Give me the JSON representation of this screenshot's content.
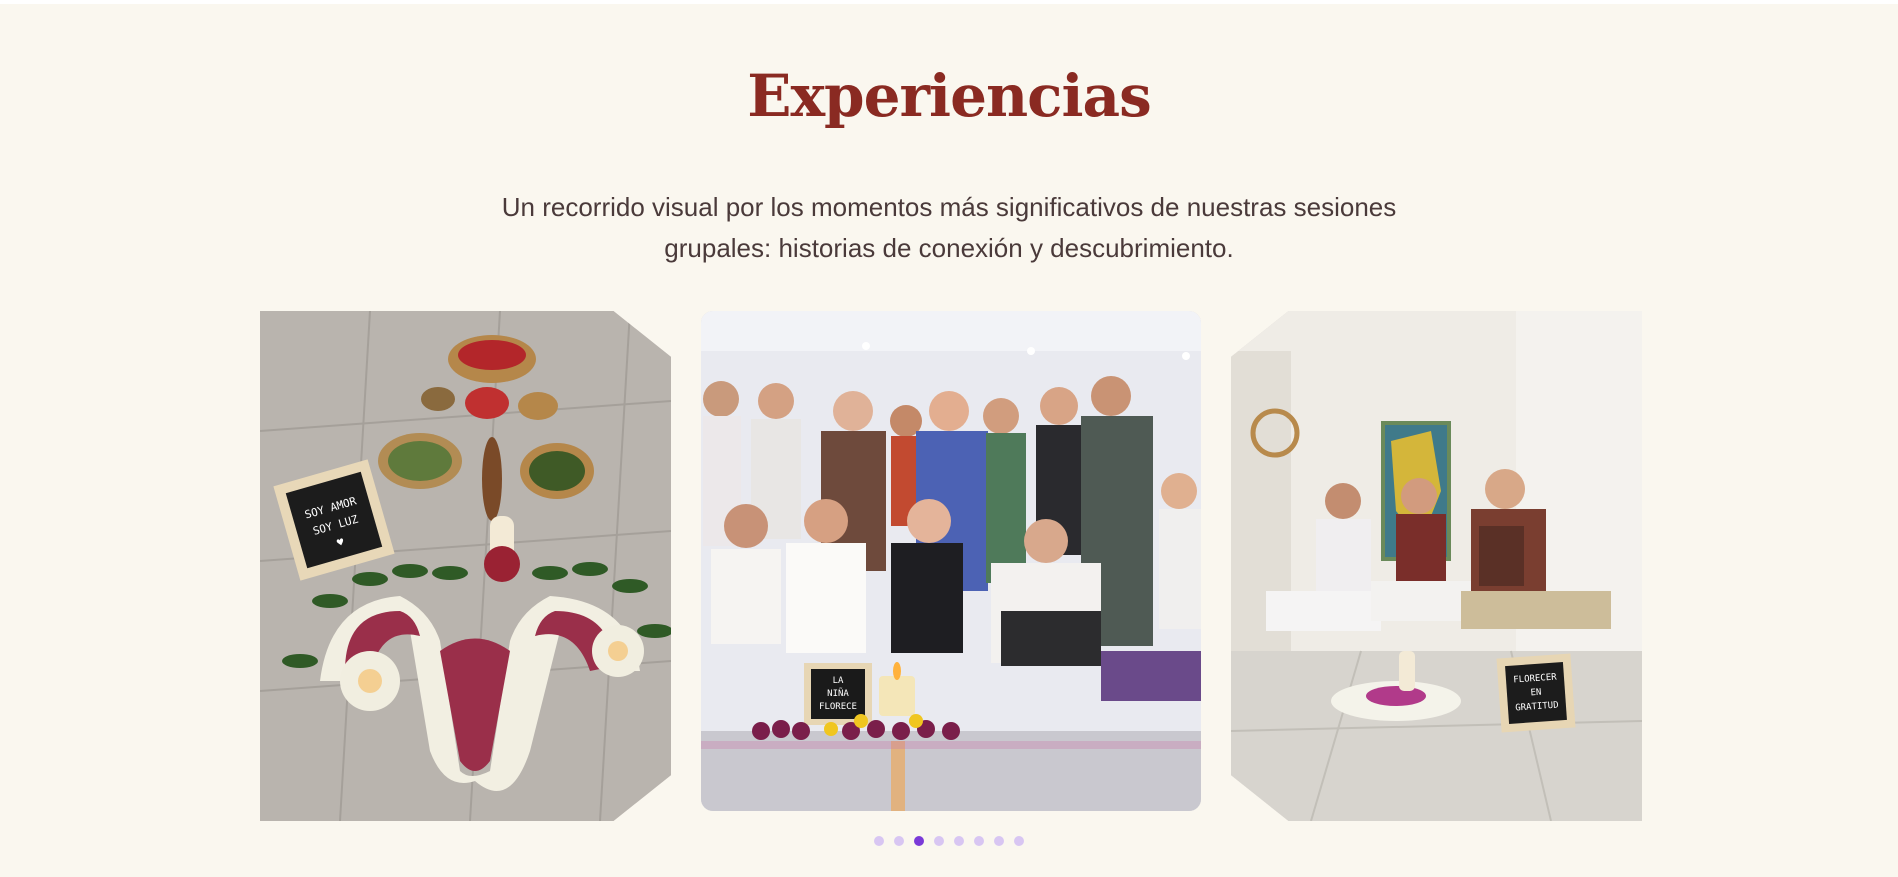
{
  "section": {
    "title": "Experiencias",
    "subtitle": "Un recorrido visual por los momentos más significativos de nuestras sesiones grupales: historias de conexión y descubrimiento."
  },
  "carousel": {
    "slides": [
      {
        "sign_lines": [
          "SOY AMOR",
          "SOY LUZ",
          "♥"
        ]
      },
      {
        "sign_lines": [
          "LA",
          "NIÑA",
          "FLORECE"
        ]
      },
      {
        "sign_lines": [
          "FLORECER",
          "EN",
          "GRATITUD"
        ]
      }
    ],
    "dot_count": 8,
    "active_index": 2
  },
  "colors": {
    "title": "#8a2a22",
    "background": "#faf7ef",
    "dot": "#d8c6f2",
    "dot_active": "#7a3ad8"
  }
}
